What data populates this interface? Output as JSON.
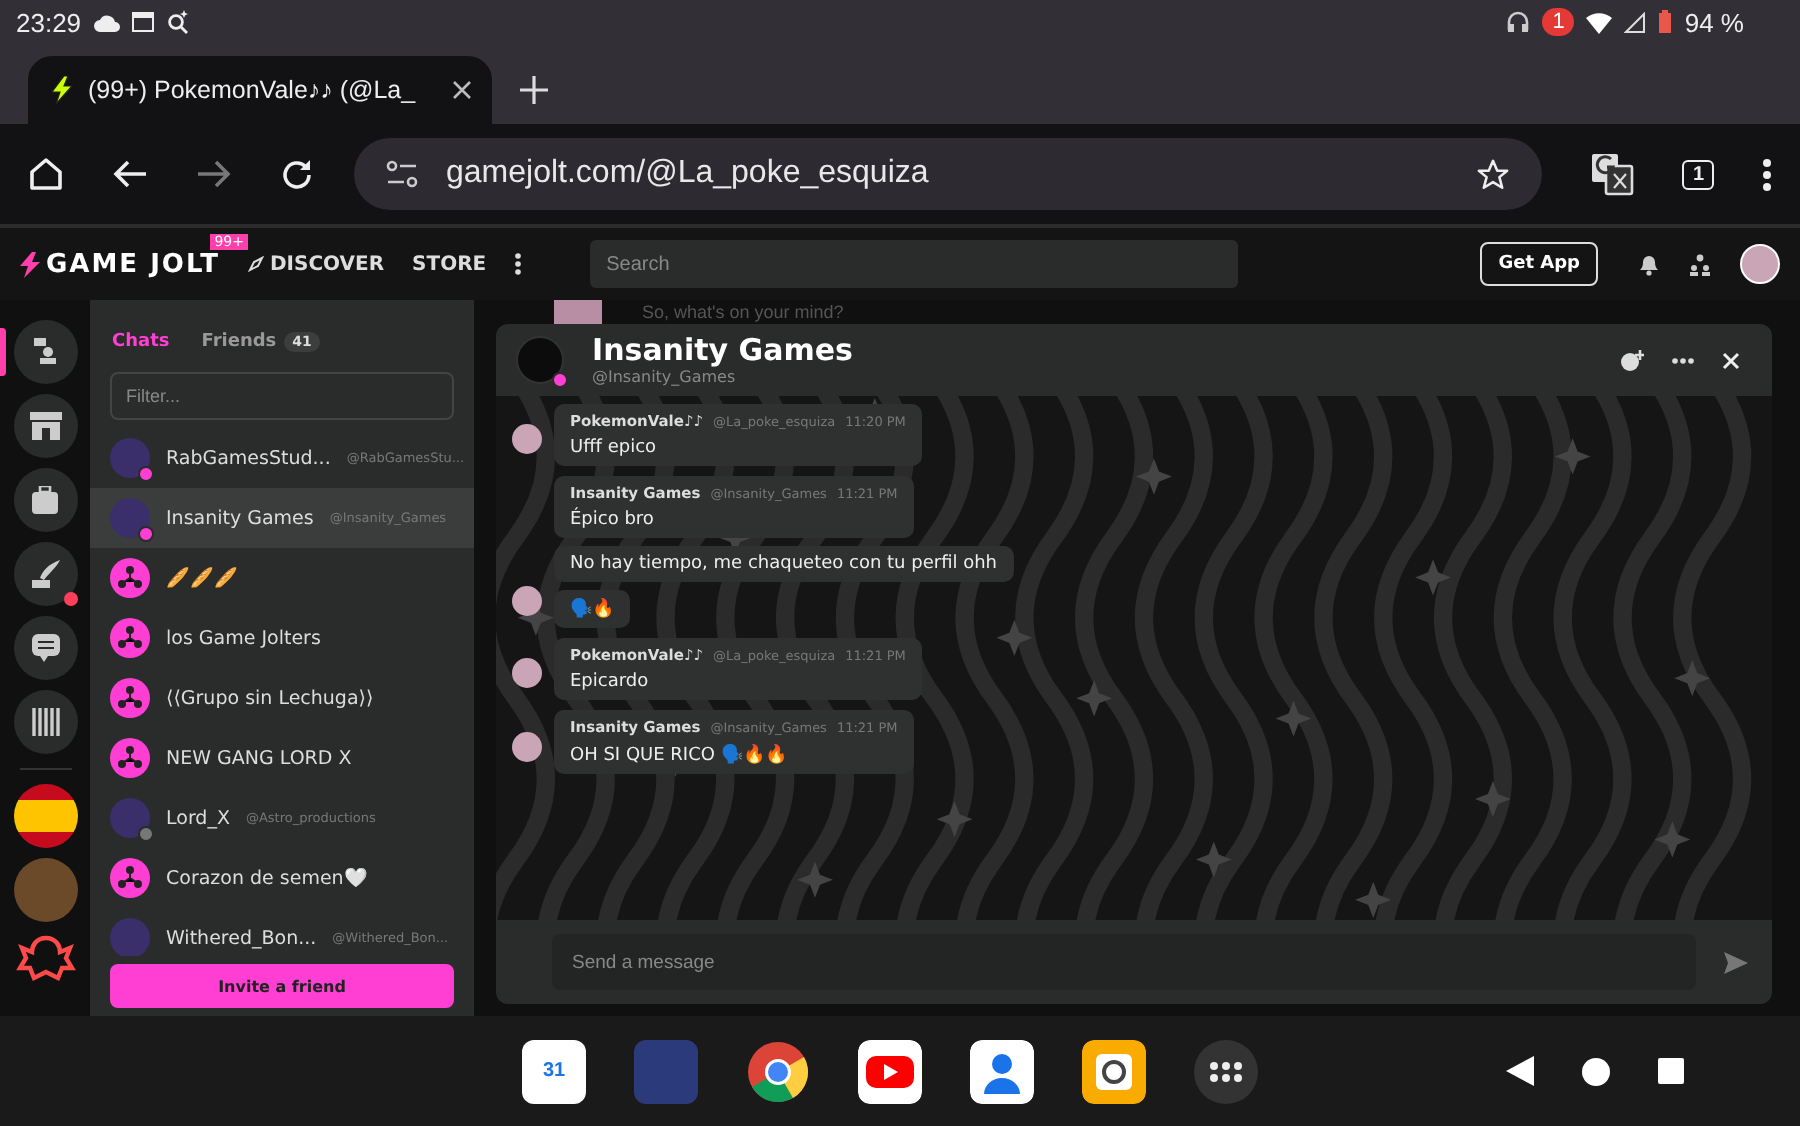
{
  "status_bar": {
    "time": "23:29",
    "notification_count": "1",
    "battery": "94 %"
  },
  "browser": {
    "tab": {
      "title": "(99+) PokemonVale♪♪ (@La_",
      "selected": true
    },
    "url": "gamejolt.com/@La_poke_esquiza",
    "tab_count": "1"
  },
  "site_header": {
    "logo": "GAME JOLT",
    "logo_badge": "99+",
    "nav": [
      "DISCOVER",
      "STORE"
    ],
    "search": {
      "placeholder": "Search"
    },
    "get_app": "Get App"
  },
  "rail": [
    {
      "kind": "activity",
      "selected": true,
      "unread": false
    },
    {
      "kind": "store",
      "selected": false,
      "unread": false
    },
    {
      "kind": "backpack",
      "selected": false,
      "unread": false
    },
    {
      "kind": "quill",
      "selected": false,
      "unread": true
    },
    {
      "kind": "chat",
      "selected": false,
      "unread": false
    },
    {
      "kind": "library",
      "selected": false,
      "unread": false
    }
  ],
  "rail_communities": [
    {
      "kind": "flag"
    },
    {
      "kind": "photo"
    },
    {
      "kind": "creature"
    }
  ],
  "chat_list": {
    "tabs": [
      {
        "label": "Chats",
        "selected": true
      },
      {
        "label": "Friends",
        "count": "41",
        "selected": false
      }
    ],
    "filter": {
      "placeholder": "Filter..."
    },
    "items": [
      {
        "name": "RabGamesStud...",
        "handle": "@RabGamesStu...",
        "kind": "user",
        "online": true,
        "selected": false
      },
      {
        "name": "Insanity Games",
        "handle": "@Insanity_Games",
        "kind": "user",
        "online": true,
        "selected": true
      },
      {
        "name": "🥖🥖🥖",
        "kind": "group",
        "selected": false
      },
      {
        "name": "los Game Jolters",
        "kind": "group",
        "selected": false
      },
      {
        "name": "⟨⟨Grupo sin Lechuga⟩⟩",
        "kind": "group",
        "selected": false
      },
      {
        "name": "NEW GANG LORD X",
        "kind": "group",
        "selected": false
      },
      {
        "name": "Lord_X",
        "handle": "@Astro_productions",
        "kind": "user",
        "online": false,
        "selected": false
      },
      {
        "name": "Corazon de semen🤍",
        "kind": "group",
        "selected": false
      },
      {
        "name": "Withered_Bon...",
        "handle": "@Withered_Bon...",
        "kind": "user",
        "selected": false
      }
    ],
    "invite": "Invite a friend"
  },
  "feed": {
    "placeholder": "So, what's on your mind?"
  },
  "chat_window": {
    "title": "Insanity Games",
    "handle": "@Insanity_Games",
    "online": true,
    "groups": [
      {
        "author": "PokemonVale♪♪",
        "handle": "@La_poke_esquiza",
        "time": "11:20 PM",
        "messages": [
          "Ufff epico"
        ]
      },
      {
        "author": "Insanity Games",
        "handle": "@Insanity_Games",
        "time": "11:21 PM",
        "messages": [
          "Épico bro",
          "No hay tiempo, me chaqueteo con tu perfil ohh",
          "🗣️🔥"
        ]
      },
      {
        "author": "PokemonVale♪♪",
        "handle": "@La_poke_esquiza",
        "time": "11:21 PM",
        "messages": [
          "Epicardo"
        ]
      },
      {
        "author": "Insanity Games",
        "handle": "@Insanity_Games",
        "time": "11:21 PM",
        "messages": [
          "OH SI QUE RICO 🗣️🔥🔥"
        ]
      }
    ],
    "input": {
      "placeholder": "Send a message"
    }
  },
  "taskbar": [
    {
      "kind": "calendar",
      "label": "31"
    },
    {
      "kind": "game"
    },
    {
      "kind": "chrome"
    },
    {
      "kind": "youtube"
    },
    {
      "kind": "contacts"
    },
    {
      "kind": "camera"
    },
    {
      "kind": "apps"
    }
  ]
}
